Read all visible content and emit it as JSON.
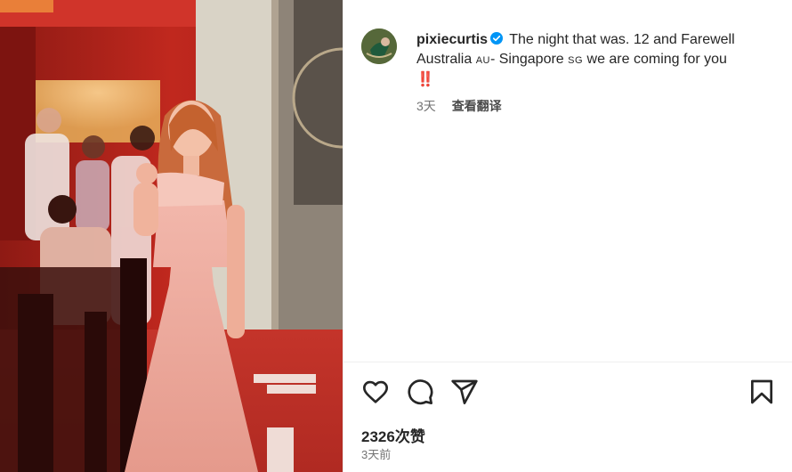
{
  "post": {
    "username": "pixiecurtis",
    "caption_lines": [
      " The night that was. 12 and Farewell",
      "Australia ",
      "- Singapore ",
      " we are coming for you"
    ],
    "flag_au": "AU",
    "flag_sg": "SG",
    "caption_end": "‼️",
    "time_short": "3天",
    "translate_label": "查看翻译",
    "likes": "2326次赞",
    "time_long": "3天前"
  },
  "icons": {
    "verified": "verified-badge-icon",
    "like": "heart-icon",
    "comment": "comment-icon",
    "share": "paper-plane-icon",
    "save": "bookmark-icon"
  },
  "colors": {
    "verified": "#0095f6",
    "text": "#262626",
    "secondary": "#737373",
    "photo_red": "#b3231c"
  }
}
